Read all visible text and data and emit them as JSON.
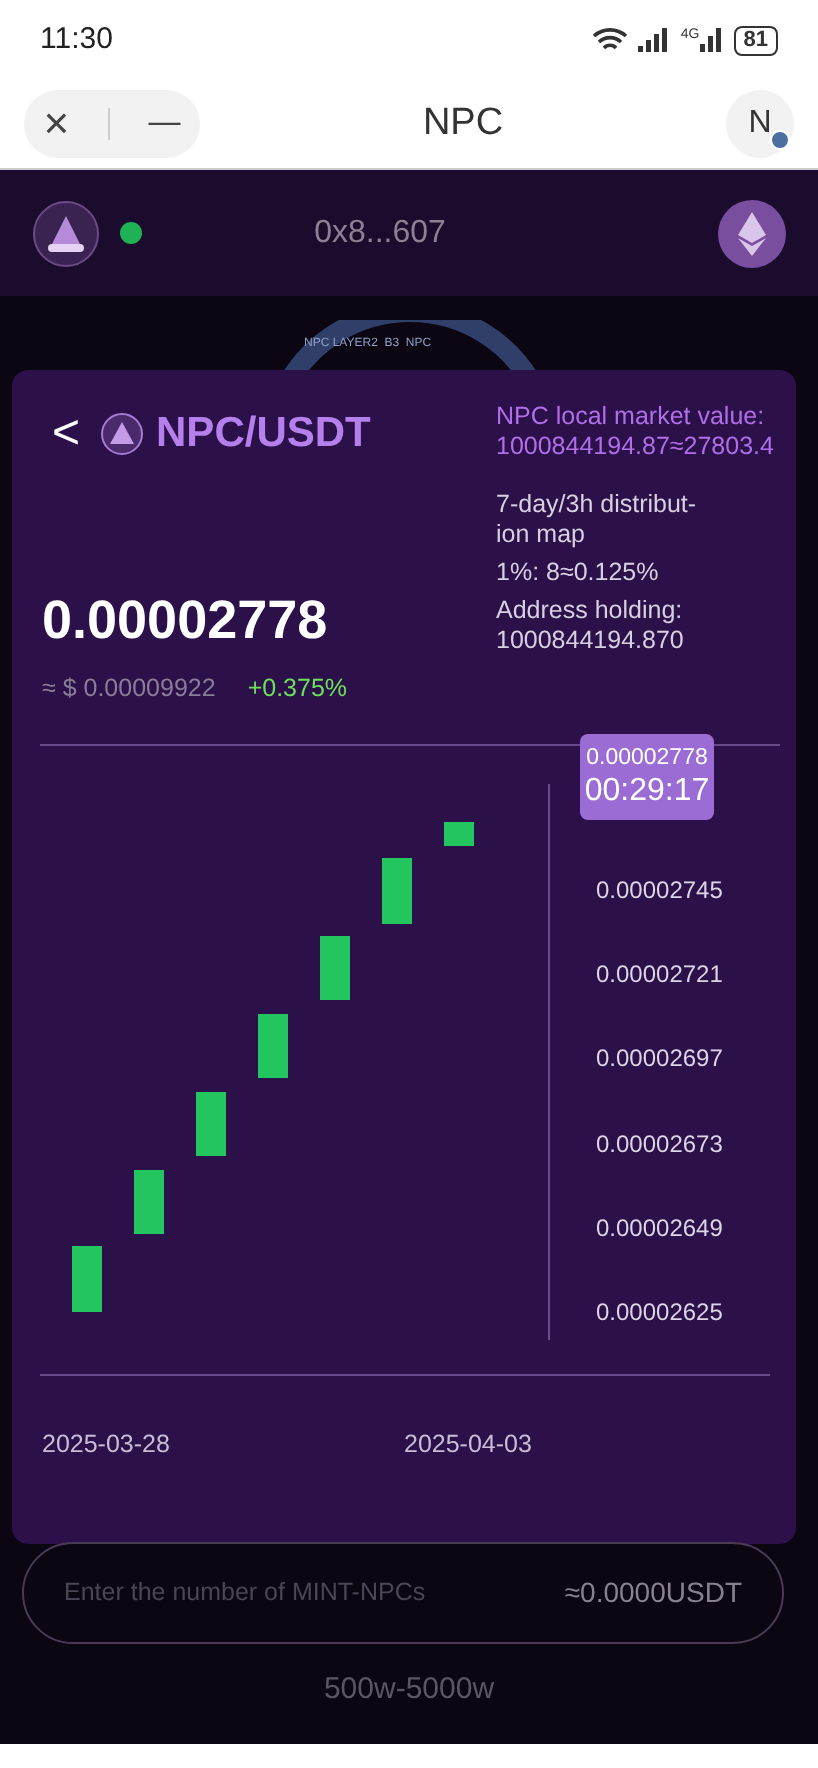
{
  "status_bar": {
    "time": "11:30",
    "battery": "81",
    "network": "4G"
  },
  "title_bar": {
    "close": "×",
    "minimize": "—",
    "title": "NPC",
    "profile": "N"
  },
  "app_header": {
    "connected": true,
    "address": "0x8...607"
  },
  "emblem": {
    "text": "NPC LAYER2  B3  NPC"
  },
  "modal": {
    "back": "<",
    "pair": "NPC/USDT",
    "price": "0.00002778",
    "usd_price": "≈ $ 0.00009922",
    "change": "+0.375%",
    "info": [
      {
        "kind": "highlight",
        "text": "NPC local market value: 1000844194.87≈27803.4"
      },
      {
        "kind": "plain",
        "text": "7-day/3h distribut-ion map"
      },
      {
        "kind": "plain",
        "text": "1%:  8≈0.125%"
      },
      {
        "kind": "plain",
        "text": "Address holding: 1000844194.870"
      }
    ],
    "chart": {
      "current_price": "0.00002778",
      "countdown": "00:29:17",
      "price_ticks": [
        "0.00002745",
        "0.00002721",
        "0.00002697",
        "0.00002673",
        "0.00002649",
        "0.00002625"
      ],
      "dates": [
        "2025-03-28",
        "2025-04-03"
      ]
    }
  },
  "mint": {
    "placeholder": "Enter the number of MINT-NPCs",
    "estimate": "≈0.0000USDT",
    "range": "500w-5000w"
  }
}
